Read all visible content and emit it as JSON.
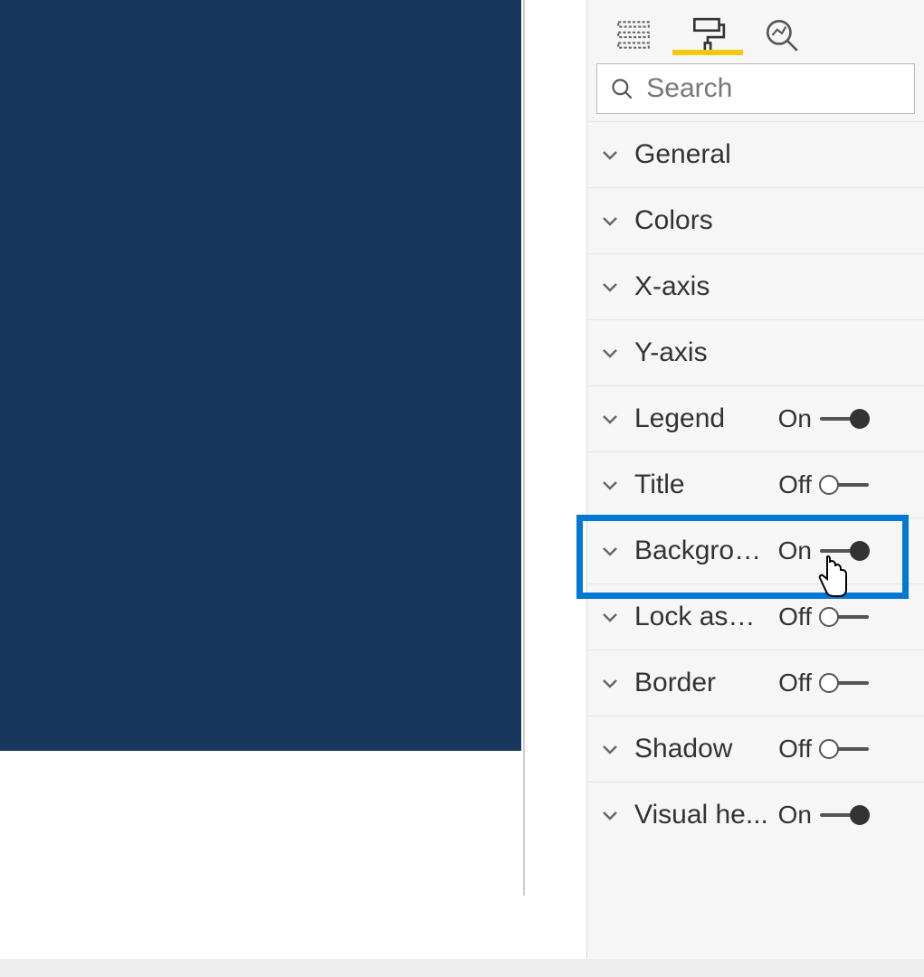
{
  "search": {
    "placeholder": "Search"
  },
  "sections": {
    "general": {
      "label": "General"
    },
    "colors": {
      "label": "Colors"
    },
    "xaxis": {
      "label": "X-axis"
    },
    "yaxis": {
      "label": "Y-axis"
    },
    "legend": {
      "label": "Legend",
      "state": "On"
    },
    "title": {
      "label": "Title",
      "state": "Off"
    },
    "background": {
      "label": "Backgrou...",
      "state": "On"
    },
    "lockaspect": {
      "label": "Lock aspe...",
      "state": "Off"
    },
    "border": {
      "label": "Border",
      "state": "Off"
    },
    "shadow": {
      "label": "Shadow",
      "state": "Off"
    },
    "visualheader": {
      "label": "Visual he...",
      "state": "On"
    }
  }
}
